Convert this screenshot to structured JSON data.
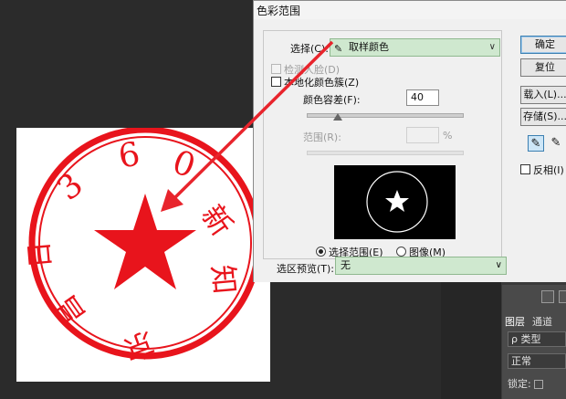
{
  "dialog": {
    "title": "色彩范围",
    "select_label": "选择(C):",
    "select_value": "取样颜色",
    "detect_faces_label": "检测人脸(D)",
    "localized_label": "本地化颜色簇(Z)",
    "fuzziness_label": "颜色容差(F):",
    "fuzziness_value": "40",
    "range_label": "范围(R):",
    "range_unit": "%",
    "selection_radio": "选择范围(E)",
    "image_radio": "图像(M)",
    "preview_label": "选区预览(T):",
    "preview_value": "无",
    "invert_label": "反相(I)"
  },
  "buttons": {
    "ok": "确定",
    "reset": "复位",
    "load": "载入(L)...",
    "save": "存储(S)..."
  },
  "stamp": {
    "chars": [
      "3",
      "6",
      "0",
      "新",
      "知",
      "京",
      "昌",
      "日"
    ],
    "color": "#e8141c"
  },
  "layers_panel": {
    "tab_layers": "图层",
    "tab_channels": "通道",
    "kind_filter": "ρ 类型",
    "blend_mode": "正常",
    "lock_label": "锁定:"
  },
  "colors": {
    "accent_green": "#cfe8cf",
    "arrow_red": "#e8242c"
  }
}
